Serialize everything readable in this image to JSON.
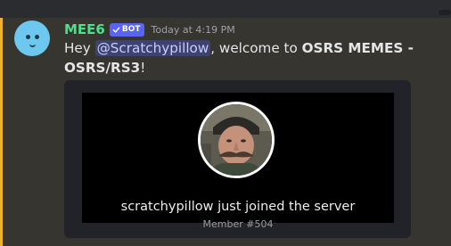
{
  "message": {
    "author": "MEE6",
    "badge": "BOT",
    "timestamp": "Today at 4:19 PM",
    "text_prefix": "Hey ",
    "mention": "@Scratchypillow",
    "text_middle": ", welcome to ",
    "server_name": "OSRS MEMES - OSRS/RS3",
    "text_suffix": "!"
  },
  "welcome_card": {
    "joined_text": "scratchypillow just joined the server",
    "member_text": "Member #504"
  },
  "colors": {
    "username": "#4ce08a",
    "badge": "#5865f2",
    "mention_bg": "#3e4270",
    "accent_bar": "#f0b132"
  },
  "icons": {
    "avatar": "mee6-face-icon",
    "badge_check": "check-icon"
  }
}
